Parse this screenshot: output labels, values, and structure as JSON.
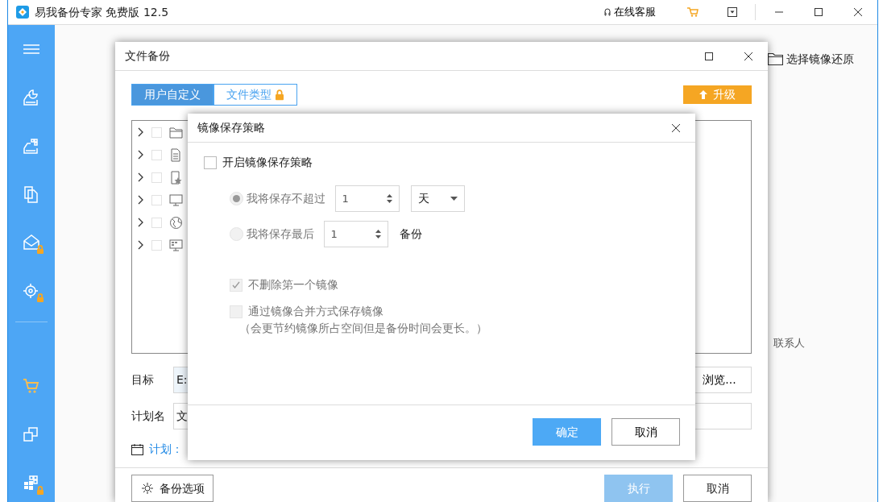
{
  "app": {
    "title": "易我备份专家 免费版 12.5",
    "support": "在线客服"
  },
  "sidebar": {
    "items": [
      {
        "kind": "disk-chart",
        "locked": false
      },
      {
        "kind": "disk-grid",
        "locked": false
      },
      {
        "kind": "files",
        "locked": false
      },
      {
        "kind": "mail",
        "locked": true
      },
      {
        "kind": "target",
        "locked": true
      },
      {
        "kind": "divider"
      },
      {
        "kind": "cart",
        "locked": false
      },
      {
        "kind": "copy",
        "locked": false
      },
      {
        "kind": "apps",
        "locked": true
      }
    ]
  },
  "main": {
    "restore_link": "选择镜像还原",
    "contacts": "联系人"
  },
  "file_backup": {
    "title": "文件备份",
    "tabs": [
      {
        "label": "用户自定义",
        "selected": true,
        "locked": false
      },
      {
        "label": "文件类型",
        "selected": false,
        "locked": true
      }
    ],
    "upgrade_button": "升级",
    "tree": {
      "items": [
        {
          "kind": "folder",
          "expanded": false,
          "checked": false
        },
        {
          "kind": "document",
          "expanded": false,
          "checked": false
        },
        {
          "kind": "favorites",
          "expanded": false,
          "checked": false
        },
        {
          "kind": "monitor",
          "expanded": false,
          "checked": false
        },
        {
          "kind": "globe",
          "expanded": false,
          "checked": false
        },
        {
          "kind": "desktop",
          "expanded": false,
          "checked": false
        }
      ]
    },
    "target": {
      "label": "目标",
      "value": "E:"
    },
    "browse_button": "浏览...",
    "plan_name": {
      "label": "计划名",
      "value": "文"
    },
    "schedule": "计划：",
    "buttons": [
      {
        "label": "备份选项",
        "kind": "options",
        "disabled": false
      },
      {
        "label": "执行",
        "kind": "primary",
        "disabled": true
      },
      {
        "label": "取消",
        "kind": "secondary",
        "disabled": false
      }
    ]
  },
  "image_policy": {
    "title": "镜像保存策略",
    "enable": {
      "label": "开启镜像保存策略",
      "checked": false
    },
    "options": [
      {
        "kind": "days",
        "label": "我将保存不超过",
        "selected": true,
        "disabled": true,
        "count": "1",
        "unit": "天"
      },
      {
        "kind": "versions",
        "label": "我将保存最后",
        "selected": false,
        "disabled": true,
        "count": "1",
        "suffix": "备份"
      }
    ],
    "keep_first": {
      "label": "不删除第一个镜像",
      "checked": true,
      "disabled": true
    },
    "merge": {
      "label": "通过镜像合并方式保存镜像",
      "checked": false,
      "disabled": true,
      "note": "（会更节约镜像所占空间但是备份时间会更长。）"
    },
    "buttons": [
      {
        "label": "确定",
        "kind": "primary"
      },
      {
        "label": "取消",
        "kind": "secondary"
      }
    ]
  }
}
